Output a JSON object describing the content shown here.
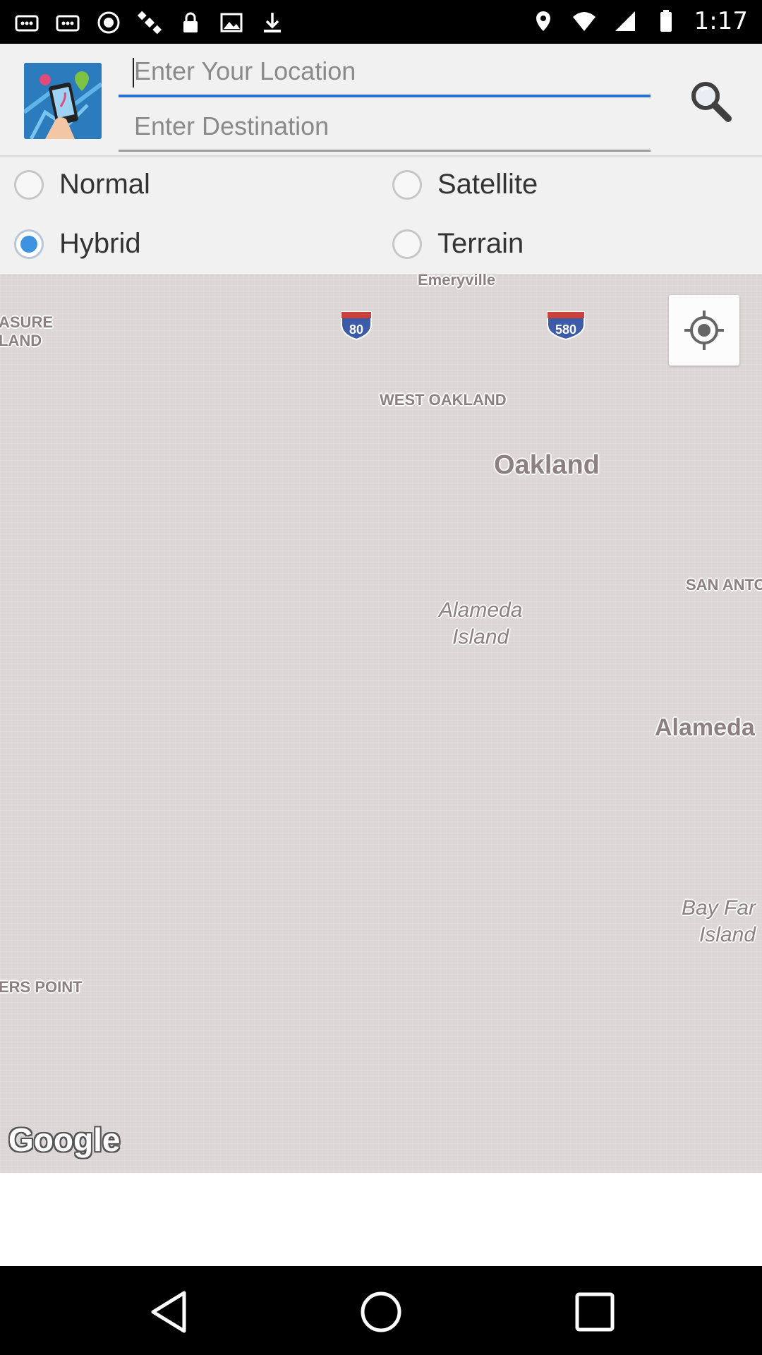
{
  "status_bar": {
    "time": "1:17",
    "left_icons": [
      "notification-icon",
      "notification-icon",
      "record-icon",
      "satellite-icon",
      "lock-icon",
      "gallery-icon",
      "download-icon"
    ],
    "right_icons": [
      "fake-gps-icon",
      "wifi-icon",
      "signal-icon",
      "battery-icon"
    ]
  },
  "header": {
    "location_placeholder": "Enter Your Location",
    "destination_placeholder": "Enter Destination",
    "search_icon": "search-icon"
  },
  "map_types": {
    "options": [
      {
        "label": "Normal",
        "checked": false
      },
      {
        "label": "Satellite",
        "checked": false
      },
      {
        "label": "Hybrid",
        "checked": true
      },
      {
        "label": "Terrain",
        "checked": false
      }
    ],
    "accent_color": "#3d93e0"
  },
  "map": {
    "labels": {
      "emeryville": "Emeryville",
      "treasure_island": "ASURE\nLAND",
      "west_oakland": "WEST OAKLAND",
      "oakland": "Oakland",
      "san_antonio": "SAN ANTO",
      "alameda_island": "Alameda\nIsland",
      "alameda": "Alameda",
      "bay_farm_island": "Bay Far\nIsland",
      "hunters_point": "ERS POINT"
    },
    "shields": {
      "i80": "80",
      "i580": "580"
    },
    "locate_icon": "my-location-icon",
    "attribution": "Google"
  },
  "nav_bar": {
    "buttons": [
      "back-icon",
      "home-icon",
      "recents-icon"
    ]
  }
}
